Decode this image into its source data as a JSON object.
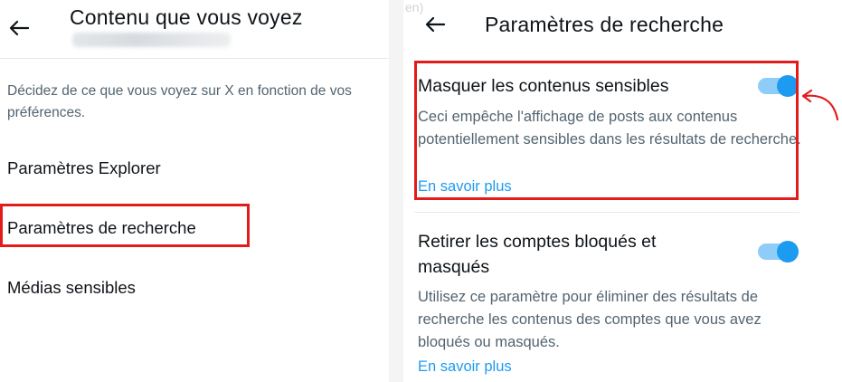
{
  "left_panel": {
    "title": "Contenu que vous voyez",
    "description": "Décidez de ce que vous voyez sur X en fonction de vos préférences.",
    "items": [
      {
        "label": "Paramètres Explorer"
      },
      {
        "label": "Paramètres de recherche"
      },
      {
        "label": "Médias sensibles"
      }
    ],
    "highlighted_item": "Paramètres de recherche"
  },
  "right_panel": {
    "watermark": "en)",
    "title": "Paramètres de recherche",
    "settings": [
      {
        "title": "Masquer les contenus sensibles",
        "description": "Ceci empêche l'affichage de posts aux contenus potentiellement sensibles dans les résultats de recherche.",
        "link": "En savoir plus",
        "enabled": true
      },
      {
        "title": "Retirer les comptes bloqués et masqués",
        "description": "Utilisez ce paramètre pour éliminer des résultats de recherche les contenus des comptes que vous avez bloqués ou masqués.",
        "link": "En savoir plus",
        "enabled": true
      }
    ]
  },
  "colors": {
    "accent": "#1d9bf0",
    "toggle_track": "#8ecdf8",
    "highlight": "#e31b1b",
    "secondary_text": "#536471"
  },
  "icons": [
    "back-arrow-icon",
    "annotation-arrow-icon"
  ]
}
